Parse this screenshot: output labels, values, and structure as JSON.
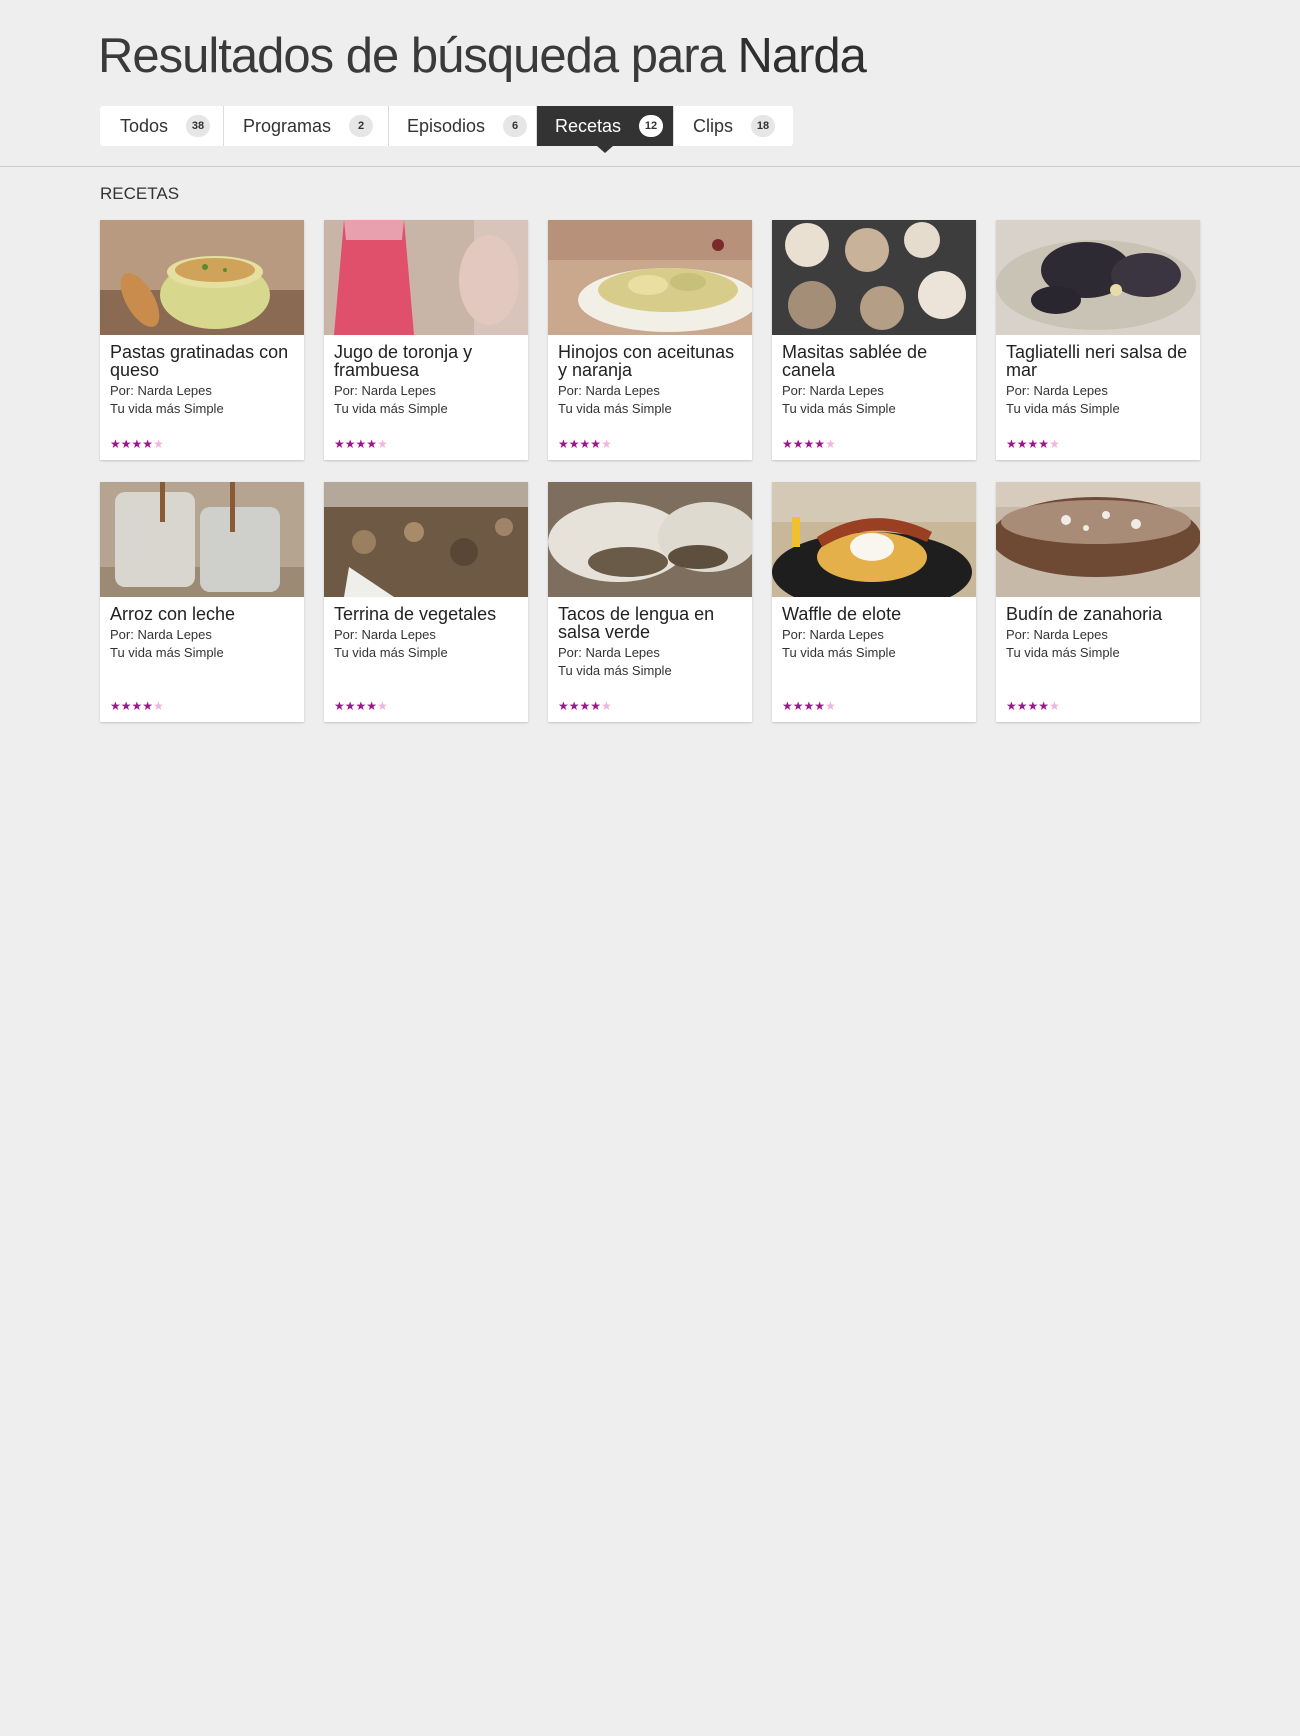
{
  "header": {
    "title_prefix": "Resultados de búsqueda para",
    "query": "Narda"
  },
  "tabs": [
    {
      "label": "Todos",
      "count": "38",
      "active": false
    },
    {
      "label": "Programas",
      "count": "2",
      "active": false
    },
    {
      "label": "Episodios",
      "count": "6",
      "active": false
    },
    {
      "label": "Recetas",
      "count": "12",
      "active": true
    },
    {
      "label": "Clips",
      "count": "18",
      "active": false
    }
  ],
  "section": {
    "title": "RECETAS"
  },
  "colors": {
    "star_on": "#a0148a",
    "star_off": "#e8b8df",
    "active_tab": "#333333"
  },
  "recipes": [
    {
      "title": "Pastas gratinadas con queso",
      "author": "Por: Narda Lepes",
      "show": "Tu vida más Simple",
      "rating": 4,
      "max_rating": 5
    },
    {
      "title": "Jugo de toronja y frambuesa",
      "author": "Por: Narda Lepes",
      "show": "Tu vida más Simple",
      "rating": 4,
      "max_rating": 5
    },
    {
      "title": "Hinojos con aceitunas y naranja",
      "author": "Por: Narda Lepes",
      "show": "Tu vida más Simple",
      "rating": 4,
      "max_rating": 5
    },
    {
      "title": "Masitas sablée de canela",
      "author": "Por: Narda Lepes",
      "show": "Tu vida más Simple",
      "rating": 4,
      "max_rating": 5
    },
    {
      "title": "Tagliatelli neri salsa de mar",
      "author": "Por: Narda Lepes",
      "show": "Tu vida más Simple",
      "rating": 4,
      "max_rating": 5
    },
    {
      "title": "Arroz con leche",
      "author": "Por: Narda Lepes",
      "show": "Tu vida más Simple",
      "rating": 4,
      "max_rating": 5
    },
    {
      "title": "Terrina de vegetales",
      "author": "Por: Narda Lepes",
      "show": "Tu vida más Simple",
      "rating": 4,
      "max_rating": 5
    },
    {
      "title": "Tacos de lengua en salsa verde",
      "author": "Por: Narda Lepes",
      "show": "Tu vida más Simple",
      "rating": 4,
      "max_rating": 5
    },
    {
      "title": "Waffle de elote",
      "author": "Por: Narda Lepes",
      "show": "Tu vida más Simple",
      "rating": 4,
      "max_rating": 5
    },
    {
      "title": "Budín de zanahoria",
      "author": "Por: Narda Lepes",
      "show": "Tu vida más Simple",
      "rating": 4,
      "max_rating": 5
    }
  ]
}
